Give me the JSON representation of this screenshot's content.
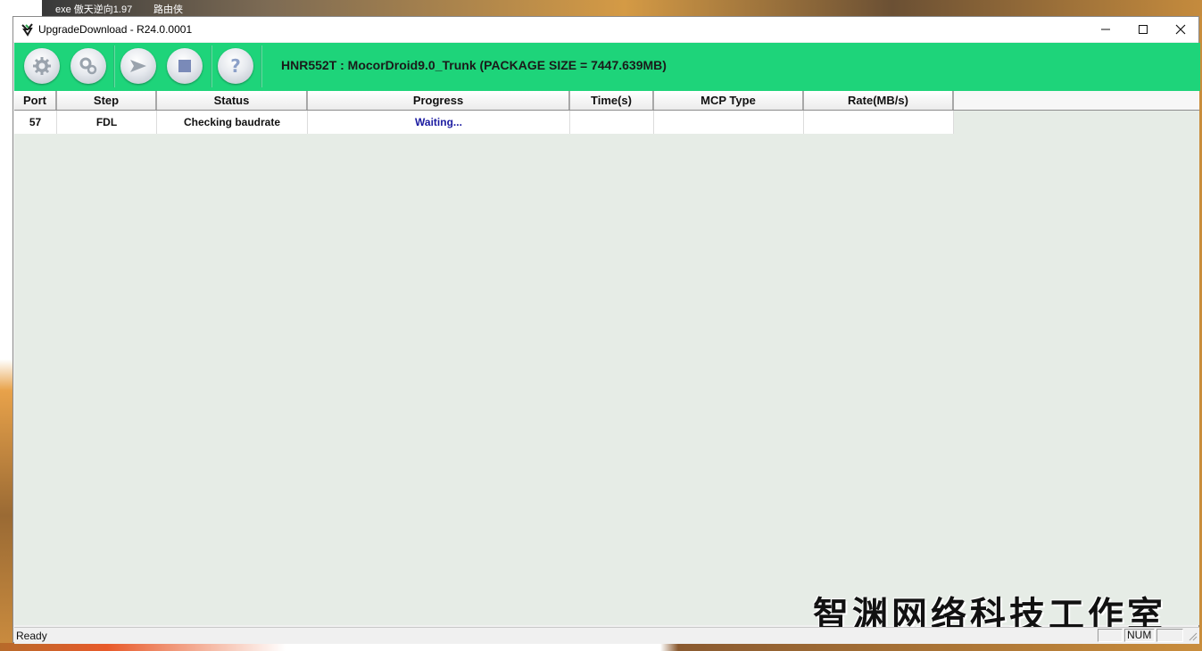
{
  "desktop": {
    "taskbar_label_1": "exe 傲天逆向1.97",
    "taskbar_label_2": "路由侠"
  },
  "window": {
    "title": "UpgradeDownload - R24.0.0001",
    "minimize_glyph": "—",
    "maximize_glyph": "☐",
    "close_glyph": "✕"
  },
  "toolbar": {
    "package_info": "HNR552T : MocorDroid9.0_Trunk (PACKAGE SIZE = 7447.639MB)",
    "accent_color": "#1ed47a",
    "buttons": [
      {
        "icon": "gear-icon"
      },
      {
        "icon": "gears-icon"
      },
      {
        "icon": "play-arrow-icon"
      },
      {
        "icon": "stop-icon"
      },
      {
        "icon": "help-icon"
      }
    ]
  },
  "table": {
    "columns": [
      "Port",
      "Step",
      "Status",
      "Progress",
      "Time(s)",
      "MCP Type",
      "Rate(MB/s)"
    ],
    "rows": [
      {
        "port": "57",
        "step": "FDL",
        "status": "Checking baudrate",
        "progress": "Waiting...",
        "time": "",
        "mcp_type": "",
        "rate": ""
      }
    ]
  },
  "watermark": "智渊网络科技工作室",
  "statusbar": {
    "text": "Ready",
    "num_indicator": "NUM"
  }
}
